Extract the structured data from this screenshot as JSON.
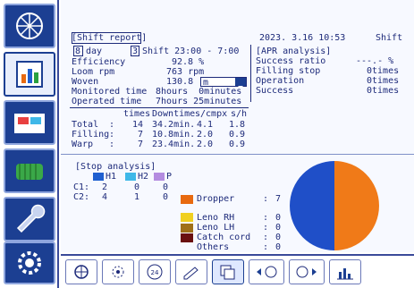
{
  "header": {
    "shift_report_label": "Shift report",
    "datetime": "2023. 3.16 10:53",
    "mode": "Shift"
  },
  "summary": {
    "days_value": "8",
    "days_unit": "day",
    "shift_num": "3",
    "shift_label": "Shift 23:00 - 7:00",
    "efficiency_label": "Efficiency",
    "efficiency_value": "92.8 %",
    "loom_rpm_label": "Loom rpm",
    "loom_rpm_value": "763 rpm",
    "woven_label": "Woven",
    "woven_value": "130.8",
    "woven_unit": "m",
    "monitored_label": "Monitored time",
    "monitored_value": "8hours  0minutes",
    "operated_label": "Operated time",
    "operated_value": "7hours 25minutes"
  },
  "apr": {
    "title": "[APR analysis]",
    "rows": [
      {
        "label": "Success ratio",
        "value": "---.- %"
      },
      {
        "label": "Filling stop",
        "value": "0times"
      },
      {
        "label": "Operation",
        "value": "0times"
      },
      {
        "label": "Success",
        "value": "0times"
      }
    ]
  },
  "stops_table": {
    "headers": [
      "times",
      "Downtime",
      "s/cmpx",
      "s/h"
    ],
    "rows": [
      {
        "label": "Total",
        "times": "14",
        "downtime": "34.2min.",
        "scmpx": "4.1",
        "sh": "1.8"
      },
      {
        "label": "Filling",
        "times": "7",
        "downtime": "10.8min.",
        "scmpx": "2.0",
        "sh": "0.9"
      },
      {
        "label": "Warp",
        "times": "7",
        "downtime": "23.4min.",
        "scmpx": "2.0",
        "sh": "0.9"
      }
    ]
  },
  "stop_analysis": {
    "title": "[Stop analysis]",
    "legend": [
      {
        "name": "H1",
        "color": "#1f5fd0"
      },
      {
        "name": "H2",
        "color": "#3fb8e8"
      },
      {
        "name": "P",
        "color": "#b48ce0"
      }
    ],
    "rows": [
      {
        "label": "C1:",
        "values": [
          "2",
          "0",
          "0"
        ]
      },
      {
        "label": "C2:",
        "values": [
          "4",
          "1",
          "0"
        ]
      }
    ],
    "categories": [
      {
        "name": "Dropper",
        "color": "#e86a10",
        "value": "7"
      },
      {
        "name": "Leno RH",
        "color": "#f0d020",
        "value": "0"
      },
      {
        "name": "Leno LH",
        "color": "#a07018",
        "value": "0"
      },
      {
        "name": "Catch cord",
        "color": "#6a1010",
        "value": "0"
      },
      {
        "name": "Others",
        "color": "#ffffff",
        "value": "0"
      }
    ]
  },
  "pie": {
    "slices": [
      {
        "name": "Dropper",
        "fraction": 0.5,
        "color": "#f07a18"
      },
      {
        "name": "Warp",
        "fraction": 0.5,
        "color": "#1f4fc8"
      }
    ]
  },
  "bottom": {
    "btn_24": "24",
    "colors": {
      "accent": "#1c3f92"
    }
  }
}
